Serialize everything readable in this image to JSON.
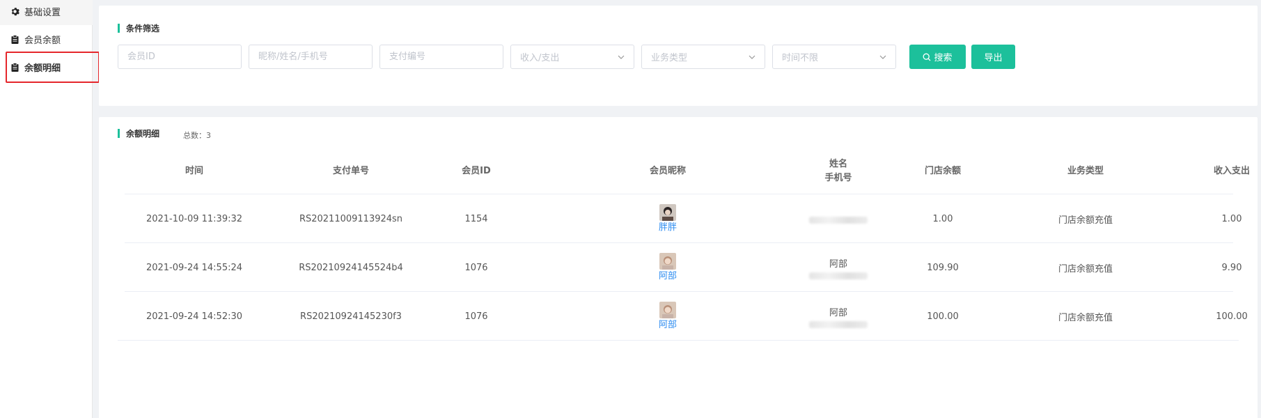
{
  "sidebar": {
    "items": [
      {
        "label": "基础设置",
        "icon": "gear-icon"
      },
      {
        "label": "会员余额",
        "icon": "clipboard-icon"
      },
      {
        "label": "余额明细",
        "icon": "clipboard-icon",
        "active": true
      }
    ]
  },
  "filter": {
    "title": "条件筛选",
    "member_id_placeholder": "会员ID",
    "name_placeholder": "昵称/姓名/手机号",
    "pay_no_placeholder": "支付编号",
    "income_select": "收入/支出",
    "biz_select": "业务类型",
    "time_select": "时间不限",
    "search_label": "搜索",
    "export_label": "导出"
  },
  "list": {
    "title": "余额明细",
    "total_label": "总数：3",
    "headers": {
      "time": "时间",
      "pay_no": "支付单号",
      "member_id": "会员ID",
      "nickname": "会员昵称",
      "name": "姓名",
      "phone": "手机号",
      "store_balance": "门店余额",
      "biz_type": "业务类型",
      "income": "收入支出"
    },
    "rows": [
      {
        "time": "2021-10-09 11:39:32",
        "pay_no": "RS20211009113924sn",
        "member_id": "1154",
        "nickname": "胖胖",
        "name": "",
        "store_balance": "1.00",
        "biz_type": "门店余额充值",
        "income": "1.00"
      },
      {
        "time": "2021-09-24 14:55:24",
        "pay_no": "RS20210924145524b4",
        "member_id": "1076",
        "nickname": "阿部",
        "name": "阿部",
        "store_balance": "109.90",
        "biz_type": "门店余额充值",
        "income": "9.90"
      },
      {
        "time": "2021-09-24 14:52:30",
        "pay_no": "RS20210924145230f3",
        "member_id": "1076",
        "nickname": "阿部",
        "name": "阿部",
        "store_balance": "100.00",
        "biz_type": "门店余额充值",
        "income": "100.00"
      }
    ]
  },
  "colors": {
    "accent": "#1cc09b",
    "link": "#2d8cf0",
    "highlight_outline": "#e5262b"
  }
}
